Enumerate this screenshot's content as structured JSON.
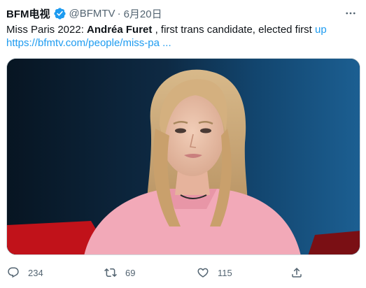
{
  "author": {
    "display_name": "BFM电视",
    "handle": "@BFMTV",
    "separator": "·",
    "date": "6月20日"
  },
  "tweet": {
    "text_plain_1": "Miss Paris 2022: ",
    "text_bold": "Andréa Furet",
    "text_plain_2": " , first trans candidate, elected first ",
    "text_link": "up",
    "url": "https://bfmtv.com/people/miss-pa ..."
  },
  "stats": {
    "replies": "234",
    "retweets": "69",
    "likes": "115"
  },
  "icons": {
    "verified": "verified-badge-icon",
    "more": "more-dots-icon",
    "reply": "reply-icon",
    "retweet": "retweet-icon",
    "like": "heart-icon",
    "share": "share-icon"
  },
  "colors": {
    "link": "#1d9bf0",
    "secondary_text": "#536471",
    "primary_text": "#0f1419"
  }
}
